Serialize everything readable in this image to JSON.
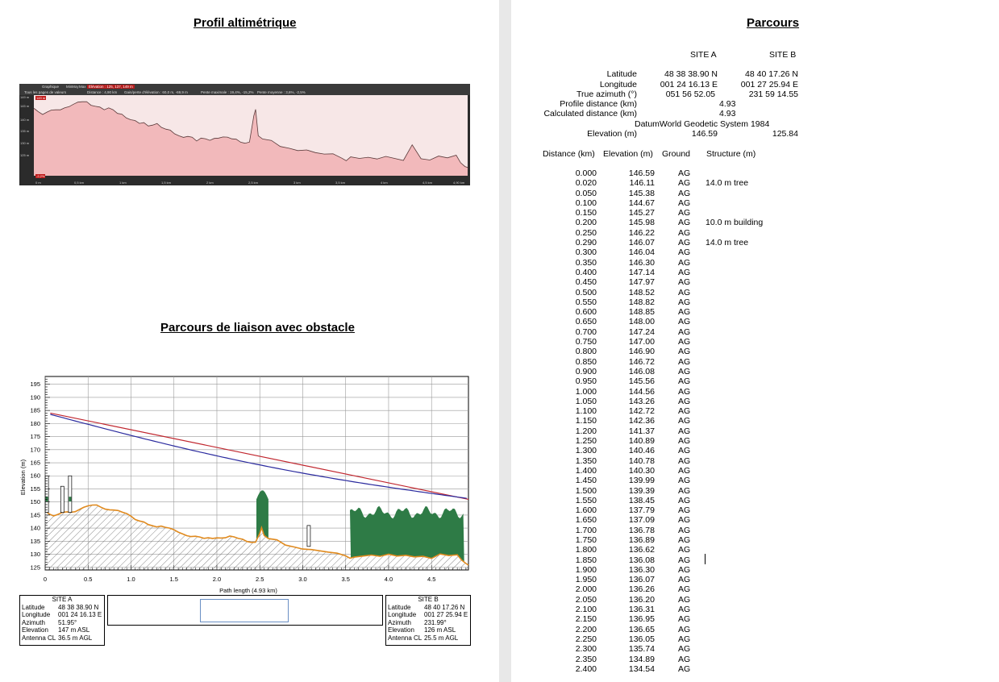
{
  "left_page": {
    "profile_title": "Profil altimétrique",
    "obstacle_title": "Parcours de liaison avec obstacle",
    "profile_image": {
      "toolbar": [
        "Graphique",
        "Min",
        "Moy",
        "Max",
        "Élévation : 125, 137, 149 m",
        "Tous les pages de valeurs",
        "Distance : 4,90 km",
        "Gain/perte d'élévation : 60,0 m, -69,9 m",
        "Pente maximale : 19,4%, -15,2%",
        "Pente moyenne : 3,6%, -2,5%"
      ],
      "y_labels": [
        "149 m",
        "145 m",
        "140 m",
        "135 m",
        "130 m",
        "125 m"
      ],
      "x_labels": [
        "0 m",
        "0,5 km",
        "1 km",
        "1,5 km",
        "2 km",
        "2,5 km",
        "3 km",
        "3,5 km",
        "4 km",
        "4,5 km",
        "4,90 km"
      ],
      "start_tag": "149 m",
      "grade_tag": "-2,2%"
    },
    "obstacle_chart": {
      "y_axis_label": "Elevation (m)",
      "y_ticks": [
        "195",
        "190",
        "185",
        "180",
        "175",
        "170",
        "165",
        "160",
        "155",
        "150",
        "145",
        "140",
        "135",
        "130",
        "125"
      ],
      "x_ticks": [
        "0",
        "0.5",
        "1.0",
        "1.5",
        "2.0",
        "2.5",
        "3.0",
        "3.5",
        "4.0",
        "4.5"
      ],
      "x_axis_label": "Path length (4.93 km)",
      "colors": {
        "terrain": "#e08a1e",
        "clutter": "#2e7b46",
        "line_red": "#c0262e",
        "line_blue": "#2a2a9e"
      }
    },
    "site_a_box": {
      "title": "SITE A",
      "rows": [
        {
          "k": "Latitude",
          "v": "48 38 38.90 N"
        },
        {
          "k": "Longitude",
          "v": "001 24 16.13 E"
        },
        {
          "k": "Azimuth",
          "v": "51.95°"
        },
        {
          "k": "Elevation",
          "v": "147 m ASL"
        },
        {
          "k": "Antenna CL",
          "v": "36.5 m AGL"
        }
      ]
    },
    "site_b_box": {
      "title": "SITE B",
      "rows": [
        {
          "k": "Latitude",
          "v": "48 40 17.26 N"
        },
        {
          "k": "Longitude",
          "v": "001 27 25.94 E"
        },
        {
          "k": "Azimuth",
          "v": "231.99°"
        },
        {
          "k": "Elevation",
          "v": "126 m ASL"
        },
        {
          "k": "Antenna CL",
          "v": "25.5 m AGL"
        }
      ]
    }
  },
  "right_page": {
    "title": "Parcours",
    "site_a": "SITE A",
    "site_b": "SITE B",
    "info": {
      "latitude_label": "Latitude",
      "latitude_a": "48 38 38.90 N",
      "latitude_b": "48 40 17.26 N",
      "longitude_label": "Longitude",
      "longitude_a": "001 24 16.13 E",
      "longitude_b": "001 27 25.94 E",
      "azimuth_label": "True azimuth (°)",
      "azimuth_a": "051 56 52.05",
      "azimuth_b": "231 59 14.55",
      "profile_distance_label": "Profile distance (km)",
      "profile_distance": "4.93",
      "calculated_distance_label": "Calculated distance (km)",
      "calculated_distance": "4.93",
      "datum": "DatumWorld Geodetic System 1984",
      "elevation_label": "Elevation (m)",
      "elevation_a": "146.59",
      "elevation_b": "125.84"
    },
    "table_headers": {
      "distance": "Distance (km)",
      "elevation": "Elevation (m)",
      "ground": "Ground",
      "structure": "Structure (m)"
    },
    "rows": [
      [
        "0.000",
        "146.59",
        "AG",
        ""
      ],
      [
        "0.020",
        "146.11",
        "AG",
        "14.0 m tree"
      ],
      [
        "0.050",
        "145.38",
        "AG",
        ""
      ],
      [
        "0.100",
        "144.67",
        "AG",
        ""
      ],
      [
        "0.150",
        "145.27",
        "AG",
        ""
      ],
      [
        "0.200",
        "145.98",
        "AG",
        "10.0 m building"
      ],
      [
        "0.250",
        "146.22",
        "AG",
        ""
      ],
      [
        "0.290",
        "146.07",
        "AG",
        "14.0 m tree"
      ],
      [
        "0.300",
        "146.04",
        "AG",
        ""
      ],
      [
        "0.350",
        "146.30",
        "AG",
        ""
      ],
      [
        "0.400",
        "147.14",
        "AG",
        ""
      ],
      [
        "0.450",
        "147.97",
        "AG",
        ""
      ],
      [
        "0.500",
        "148.52",
        "AG",
        ""
      ],
      [
        "0.550",
        "148.82",
        "AG",
        ""
      ],
      [
        "0.600",
        "148.85",
        "AG",
        ""
      ],
      [
        "0.650",
        "148.00",
        "AG",
        ""
      ],
      [
        "0.700",
        "147.24",
        "AG",
        ""
      ],
      [
        "0.750",
        "147.00",
        "AG",
        ""
      ],
      [
        "0.800",
        "146.90",
        "AG",
        ""
      ],
      [
        "0.850",
        "146.72",
        "AG",
        ""
      ],
      [
        "0.900",
        "146.08",
        "AG",
        ""
      ],
      [
        "0.950",
        "145.56",
        "AG",
        ""
      ],
      [
        "1.000",
        "144.56",
        "AG",
        ""
      ],
      [
        "1.050",
        "143.26",
        "AG",
        ""
      ],
      [
        "1.100",
        "142.72",
        "AG",
        ""
      ],
      [
        "1.150",
        "142.36",
        "AG",
        ""
      ],
      [
        "1.200",
        "141.37",
        "AG",
        ""
      ],
      [
        "1.250",
        "140.89",
        "AG",
        ""
      ],
      [
        "1.300",
        "140.46",
        "AG",
        ""
      ],
      [
        "1.350",
        "140.78",
        "AG",
        ""
      ],
      [
        "1.400",
        "140.30",
        "AG",
        ""
      ],
      [
        "1.450",
        "139.99",
        "AG",
        ""
      ],
      [
        "1.500",
        "139.39",
        "AG",
        ""
      ],
      [
        "1.550",
        "138.45",
        "AG",
        ""
      ],
      [
        "1.600",
        "137.79",
        "AG",
        ""
      ],
      [
        "1.650",
        "137.09",
        "AG",
        ""
      ],
      [
        "1.700",
        "136.78",
        "AG",
        ""
      ],
      [
        "1.750",
        "136.89",
        "AG",
        ""
      ],
      [
        "1.800",
        "136.62",
        "AG",
        ""
      ],
      [
        "1.850",
        "136.08",
        "AG",
        ""
      ],
      [
        "1.900",
        "136.30",
        "AG",
        ""
      ],
      [
        "1.950",
        "136.07",
        "AG",
        ""
      ],
      [
        "2.000",
        "136.26",
        "AG",
        ""
      ],
      [
        "2.050",
        "136.20",
        "AG",
        ""
      ],
      [
        "2.100",
        "136.31",
        "AG",
        ""
      ],
      [
        "2.150",
        "136.95",
        "AG",
        ""
      ],
      [
        "2.200",
        "136.65",
        "AG",
        ""
      ],
      [
        "2.250",
        "136.05",
        "AG",
        ""
      ],
      [
        "2.300",
        "135.74",
        "AG",
        ""
      ],
      [
        "2.350",
        "134.89",
        "AG",
        ""
      ],
      [
        "2.400",
        "134.54",
        "AG",
        ""
      ]
    ]
  }
}
